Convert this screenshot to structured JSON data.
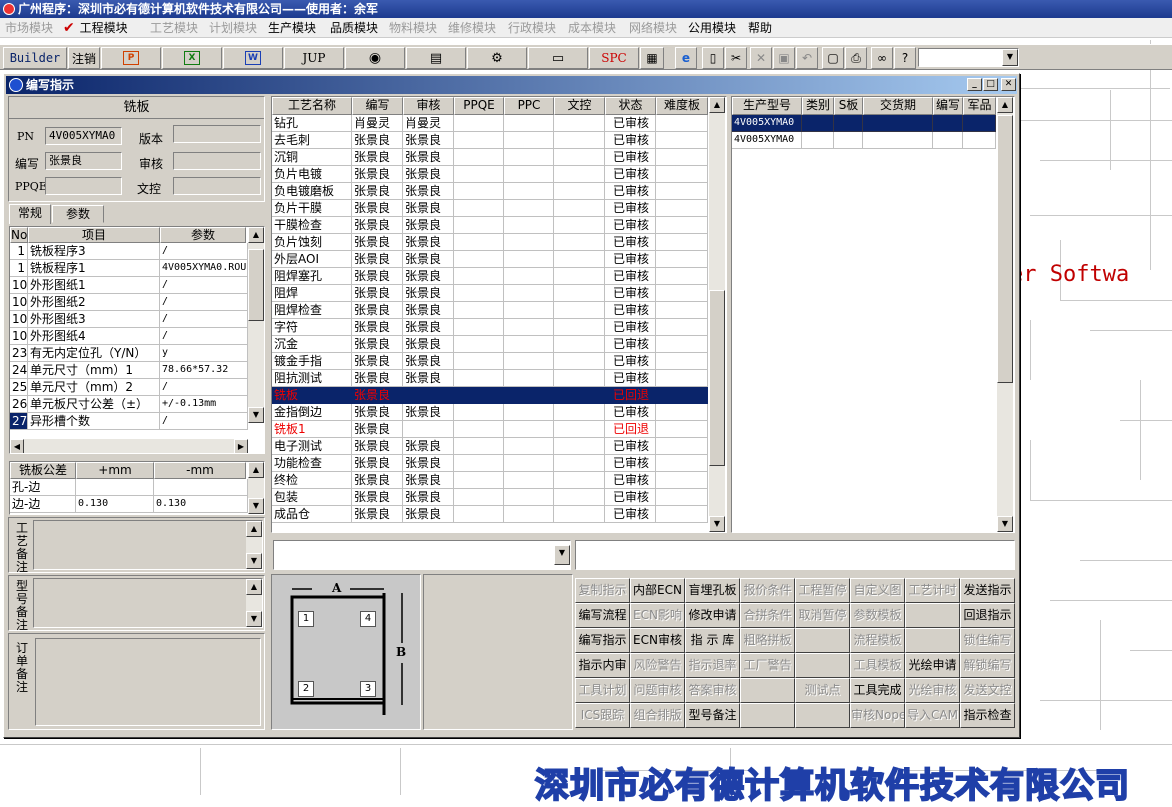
{
  "app_title": "广州程序：深圳市必有德计算机软件技术有限公司——使用者：余军",
  "menu": [
    {
      "label": "市场模块",
      "disabled": true
    },
    {
      "label": "工程模块",
      "disabled": false,
      "checked": true
    },
    {
      "label": "工艺模块",
      "disabled": true
    },
    {
      "label": "计划模块",
      "disabled": true
    },
    {
      "label": "生产模块",
      "disabled": false
    },
    {
      "label": "品质模块",
      "disabled": false
    },
    {
      "label": "物料模块",
      "disabled": true
    },
    {
      "label": "维修模块",
      "disabled": true
    },
    {
      "label": "行政模块",
      "disabled": true
    },
    {
      "label": "成本模块",
      "disabled": true
    },
    {
      "label": "网络模块",
      "disabled": true
    },
    {
      "label": "公用模块",
      "disabled": false
    },
    {
      "label": "帮助",
      "disabled": false
    }
  ],
  "toolbar": {
    "builder": "Builder",
    "logout": "注销",
    "jup": "JUP",
    "spc": "SPC"
  },
  "window": {
    "title": "编写指示"
  },
  "background": {
    "brand_text": "er Softwa",
    "company_text": "深圳市必有德计算机软件技术有限公司"
  },
  "left": {
    "header": "铣板",
    "pn_label": "PN",
    "pn_value": "4V005XYMA0",
    "version_label": "版本",
    "version_value": "",
    "writer_label": "编写",
    "writer_value": "张景良",
    "review_label": "审核",
    "review_value": "",
    "ppqe_label": "PPQE",
    "ppqe_value": "",
    "doc_label": "文控",
    "doc_value": "",
    "tabs": [
      "常规",
      "参数"
    ],
    "param_headers": [
      "No",
      "项目",
      "参数"
    ],
    "params": [
      {
        "no": "1",
        "item": "铣板程序3",
        "value": "/"
      },
      {
        "no": "1",
        "item": "铣板程序1",
        "value": "4V005XYMA0.ROU"
      },
      {
        "no": "10",
        "item": "外形图纸1",
        "value": "/"
      },
      {
        "no": "10",
        "item": "外形图纸2",
        "value": "/"
      },
      {
        "no": "10",
        "item": "外形图纸3",
        "value": "/"
      },
      {
        "no": "10",
        "item": "外形图纸4",
        "value": "/"
      },
      {
        "no": "23",
        "item": "有无内定位孔（Y/N）",
        "value": "y"
      },
      {
        "no": "24",
        "item": "单元尺寸（mm）1",
        "value": "78.66*57.32"
      },
      {
        "no": "25",
        "item": "单元尺寸（mm）2",
        "value": "/"
      },
      {
        "no": "26",
        "item": "单元板尺寸公差（±）",
        "value": "+/-0.13mm"
      },
      {
        "no": "27",
        "item": "异形槽个数",
        "value": "/"
      }
    ],
    "tol_headers": [
      "铣板公差",
      "+mm",
      "-mm"
    ],
    "tolerances": [
      {
        "name": "孔-边",
        "plus": "",
        "minus": ""
      },
      {
        "name": "边-边",
        "plus": "0.130",
        "minus": "0.130"
      }
    ],
    "notes": [
      "工艺备注",
      "型号备注",
      "订单备注"
    ]
  },
  "process": {
    "headers": [
      "工艺名称",
      "编写",
      "审核",
      "PPQE",
      "PPC",
      "文控",
      "状态",
      "难度板"
    ],
    "rows": [
      {
        "name": "钻孔",
        "writer": "肖曼灵",
        "reviewer": "肖曼灵",
        "status": "已审核",
        "flag": "normal"
      },
      {
        "name": "去毛刺",
        "writer": "张景良",
        "reviewer": "张景良",
        "status": "已审核",
        "flag": "normal"
      },
      {
        "name": "沉铜",
        "writer": "张景良",
        "reviewer": "张景良",
        "status": "已审核",
        "flag": "normal"
      },
      {
        "name": "负片电镀",
        "writer": "张景良",
        "reviewer": "张景良",
        "status": "已审核",
        "flag": "normal"
      },
      {
        "name": "负电镀磨板",
        "writer": "张景良",
        "reviewer": "张景良",
        "status": "已审核",
        "flag": "normal"
      },
      {
        "name": "负片干膜",
        "writer": "张景良",
        "reviewer": "张景良",
        "status": "已审核",
        "flag": "normal"
      },
      {
        "name": "干膜检查",
        "writer": "张景良",
        "reviewer": "张景良",
        "status": "已审核",
        "flag": "normal"
      },
      {
        "name": "负片蚀刻",
        "writer": "张景良",
        "reviewer": "张景良",
        "status": "已审核",
        "flag": "normal"
      },
      {
        "name": "外层AOI",
        "writer": "张景良",
        "reviewer": "张景良",
        "status": "已审核",
        "flag": "normal"
      },
      {
        "name": "阻焊塞孔",
        "writer": "张景良",
        "reviewer": "张景良",
        "status": "已审核",
        "flag": "normal"
      },
      {
        "name": "阻焊",
        "writer": "张景良",
        "reviewer": "张景良",
        "status": "已审核",
        "flag": "normal"
      },
      {
        "name": "阻焊检查",
        "writer": "张景良",
        "reviewer": "张景良",
        "status": "已审核",
        "flag": "normal"
      },
      {
        "name": "字符",
        "writer": "张景良",
        "reviewer": "张景良",
        "status": "已审核",
        "flag": "normal"
      },
      {
        "name": "沉金",
        "writer": "张景良",
        "reviewer": "张景良",
        "status": "已审核",
        "flag": "normal"
      },
      {
        "name": "镀金手指",
        "writer": "张景良",
        "reviewer": "张景良",
        "status": "已审核",
        "flag": "normal"
      },
      {
        "name": "阻抗测试",
        "writer": "张景良",
        "reviewer": "张景良",
        "status": "已审核",
        "flag": "normal"
      },
      {
        "name": "铣板",
        "writer": "张景良",
        "reviewer": "",
        "status": "已回退",
        "flag": "selected"
      },
      {
        "name": "金指倒边",
        "writer": "张景良",
        "reviewer": "张景良",
        "status": "已审核",
        "flag": "normal"
      },
      {
        "name": "铣板1",
        "writer": "张景良",
        "reviewer": "",
        "status": "已回退",
        "flag": "red"
      },
      {
        "name": "电子测试",
        "writer": "张景良",
        "reviewer": "张景良",
        "status": "已审核",
        "flag": "normal"
      },
      {
        "name": "功能检查",
        "writer": "张景良",
        "reviewer": "张景良",
        "status": "已审核",
        "flag": "normal"
      },
      {
        "name": "终检",
        "writer": "张景良",
        "reviewer": "张景良",
        "status": "已审核",
        "flag": "normal"
      },
      {
        "name": "包装",
        "writer": "张景良",
        "reviewer": "张景良",
        "status": "已审核",
        "flag": "normal"
      },
      {
        "name": "成品仓",
        "writer": "张景良",
        "reviewer": "张景良",
        "status": "已审核",
        "flag": "normal"
      }
    ]
  },
  "models": {
    "headers": [
      "生产型号",
      "类别",
      "S板",
      "交货期",
      "编写",
      "军品"
    ],
    "rows": [
      {
        "model": "4V005XYMA0",
        "selected": true
      },
      {
        "model": "4V005XYMA0",
        "selected": false
      }
    ]
  },
  "diagram": {
    "label_a": "A",
    "label_b": "B",
    "corners": [
      "1",
      "4",
      "2",
      "3"
    ]
  },
  "buttons": [
    [
      {
        "label": "复制指示",
        "disabled": true
      },
      {
        "label": "内部ECN",
        "disabled": false
      },
      {
        "label": "盲埋孔板",
        "disabled": false
      },
      {
        "label": "报价条件",
        "disabled": true
      },
      {
        "label": "工程暂停",
        "disabled": true
      },
      {
        "label": "自定义图",
        "disabled": true
      },
      {
        "label": "工艺计时",
        "disabled": true
      },
      {
        "label": "发送指示",
        "disabled": false
      }
    ],
    [
      {
        "label": "编写流程",
        "disabled": false
      },
      {
        "label": "ECN影响",
        "disabled": true
      },
      {
        "label": "修改申请",
        "disabled": false
      },
      {
        "label": "合拼条件",
        "disabled": true
      },
      {
        "label": "取消暂停",
        "disabled": true
      },
      {
        "label": "参数模板",
        "disabled": true
      },
      {
        "label": "",
        "disabled": true
      },
      {
        "label": "回退指示",
        "disabled": false
      }
    ],
    [
      {
        "label": "编写指示",
        "disabled": false
      },
      {
        "label": "ECN审核",
        "disabled": false
      },
      {
        "label": "指 示 库",
        "disabled": false
      },
      {
        "label": "粗略拼板",
        "disabled": true
      },
      {
        "label": "",
        "disabled": true
      },
      {
        "label": "流程模板",
        "disabled": true
      },
      {
        "label": "",
        "disabled": true
      },
      {
        "label": "锁住编写",
        "disabled": true
      }
    ],
    [
      {
        "label": "指示内审",
        "disabled": false
      },
      {
        "label": "风险警告",
        "disabled": true
      },
      {
        "label": "指示退率",
        "disabled": true
      },
      {
        "label": "工厂警告",
        "disabled": true
      },
      {
        "label": "",
        "disabled": true
      },
      {
        "label": "工具模板",
        "disabled": true
      },
      {
        "label": "光绘申请",
        "disabled": false
      },
      {
        "label": "解锁编写",
        "disabled": true
      }
    ],
    [
      {
        "label": "工具计划",
        "disabled": true
      },
      {
        "label": "问题审核",
        "disabled": true
      },
      {
        "label": "答案审核",
        "disabled": true
      },
      {
        "label": "",
        "disabled": true
      },
      {
        "label": "测试点",
        "disabled": true
      },
      {
        "label": "工具完成",
        "disabled": false
      },
      {
        "label": "光绘审核",
        "disabled": true
      },
      {
        "label": "发送文控",
        "disabled": true
      }
    ],
    [
      {
        "label": "ICS跟踪",
        "disabled": true
      },
      {
        "label": "组合排版",
        "disabled": true
      },
      {
        "label": "型号备注",
        "disabled": false
      },
      {
        "label": "",
        "disabled": true
      },
      {
        "label": "",
        "disabled": true
      },
      {
        "label": "审核Nope",
        "disabled": true
      },
      {
        "label": "导入CAM",
        "disabled": true
      },
      {
        "label": "指示检查",
        "disabled": false
      }
    ]
  ]
}
